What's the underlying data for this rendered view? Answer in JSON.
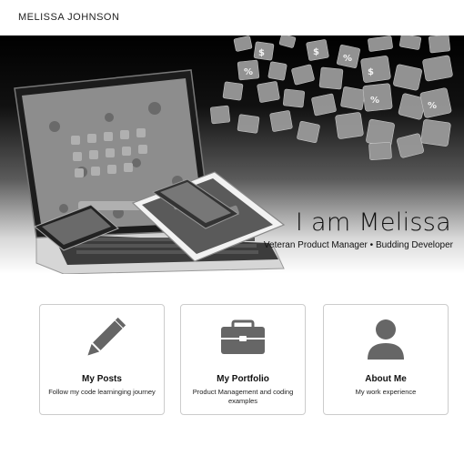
{
  "header": {
    "site_name": "MELISSA JOHNSON"
  },
  "hero": {
    "title": "I am Melissa",
    "subtitle": "Veteran Product Manager • Budding Developer"
  },
  "cards": [
    {
      "title": "My Posts",
      "description": "Follow my code learninging journey",
      "icon": "pencil-icon"
    },
    {
      "title": "My Portfolio",
      "description": "Product Management and coding examples",
      "icon": "briefcase-icon"
    },
    {
      "title": "About Me",
      "description": "My work experience",
      "icon": "person-icon"
    }
  ]
}
